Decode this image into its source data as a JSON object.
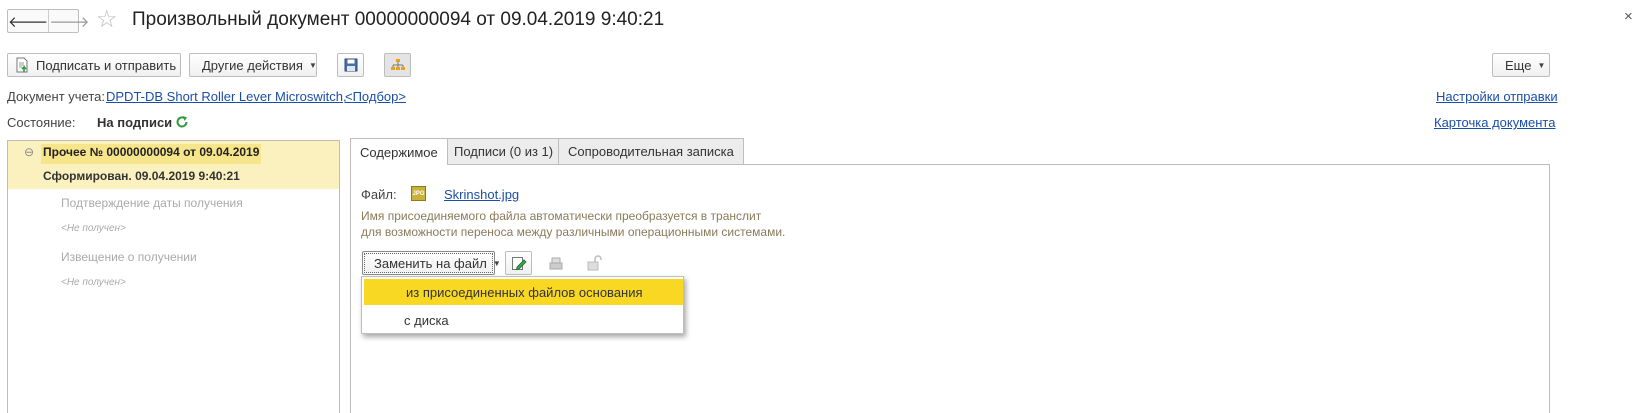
{
  "window": {
    "title": "Произвольный документ 00000000094 от 09.04.2019 9:40:21",
    "back_symbol": "🡐",
    "forward_symbol": "🡒",
    "star_symbol": "☆",
    "close_symbol": "×"
  },
  "toolbar": {
    "sign_send_label": "Подписать и отправить",
    "other_actions_label": "Другие действия",
    "more_label": "Еще",
    "caret": "▼"
  },
  "header": {
    "account_doc_label": "Документ учета:",
    "account_doc_value": "DPDT-DB Short Roller Lever Microswitch,",
    "select_link": "<Подбор>",
    "state_label": "Состояние:",
    "state_value": "На подписи",
    "send_settings_link": "Настройки отправки",
    "doc_card_link": "Карточка документа"
  },
  "tree": {
    "collapse_symbol": "⊖",
    "root_label": "Прочее № 00000000094 от 09.04.2019",
    "formed_label": "Сформирован. 09.04.2019 9:40:21",
    "items": [
      {
        "label": "Подтверждение даты получения",
        "status": "<Не получен>"
      },
      {
        "label": "Извещение о получении",
        "status": "<Не получен>"
      }
    ]
  },
  "tabs": [
    {
      "label": "Содержимое",
      "active": true
    },
    {
      "label": "Подписи (0 из 1)",
      "active": false
    },
    {
      "label": "Сопроводительная записка",
      "active": false
    }
  ],
  "content": {
    "file_label": "Файл:",
    "file_name": "Skrinshot.jpg",
    "file_icon_text": "JPG",
    "hint_line1": "Имя присоединяемого файла автоматически преобразуется в транслит",
    "hint_line2": "для возможности переноса между различными операционными системами.",
    "replace_button": "Заменить на файл"
  },
  "dropdown": {
    "items": [
      {
        "label": "из присоединенных файлов основания",
        "selected": true
      },
      {
        "label": "с диска",
        "selected": false
      }
    ]
  },
  "colors": {
    "link": "#1a4fa8",
    "tree_selection": "#fbf1bf",
    "menu_highlight": "#f9d823",
    "refresh_green": "#2e9e3a",
    "hint_text": "#8a7a5a"
  }
}
